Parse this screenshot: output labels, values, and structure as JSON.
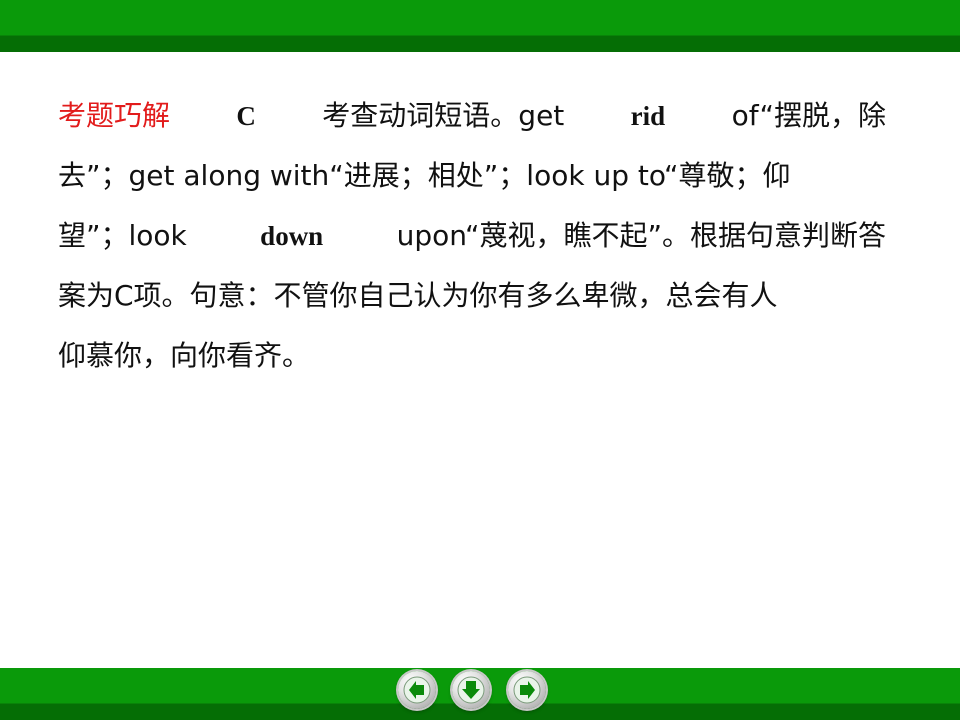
{
  "explanation": {
    "heading": "考题巧解",
    "line1": {
      "parts": [
        "C",
        "考查动词短语。get",
        "rid",
        "of“摆脱，除"
      ]
    },
    "line2": {
      "parts": [
        "去”；get along with“进展；相处”；look up to“尊敬；仰"
      ]
    },
    "line3": {
      "parts": [
        "望”；look",
        "down",
        "upon“蔑视，瞧不起”。根据句意判断答"
      ]
    },
    "line4": "案为C项。句意：不管你自己认为你有多么卑微，总会有人",
    "line5": "仰慕你，向你看齐。"
  },
  "nav": {
    "prev": "arrow-left-icon",
    "down": "arrow-down-icon",
    "next": "arrow-right-icon"
  },
  "colors": {
    "accent": "#e21b1b",
    "bar_light": "#0a9a0a",
    "bar_dark": "#056e05",
    "nav_arrow": "#0a8a0a"
  }
}
